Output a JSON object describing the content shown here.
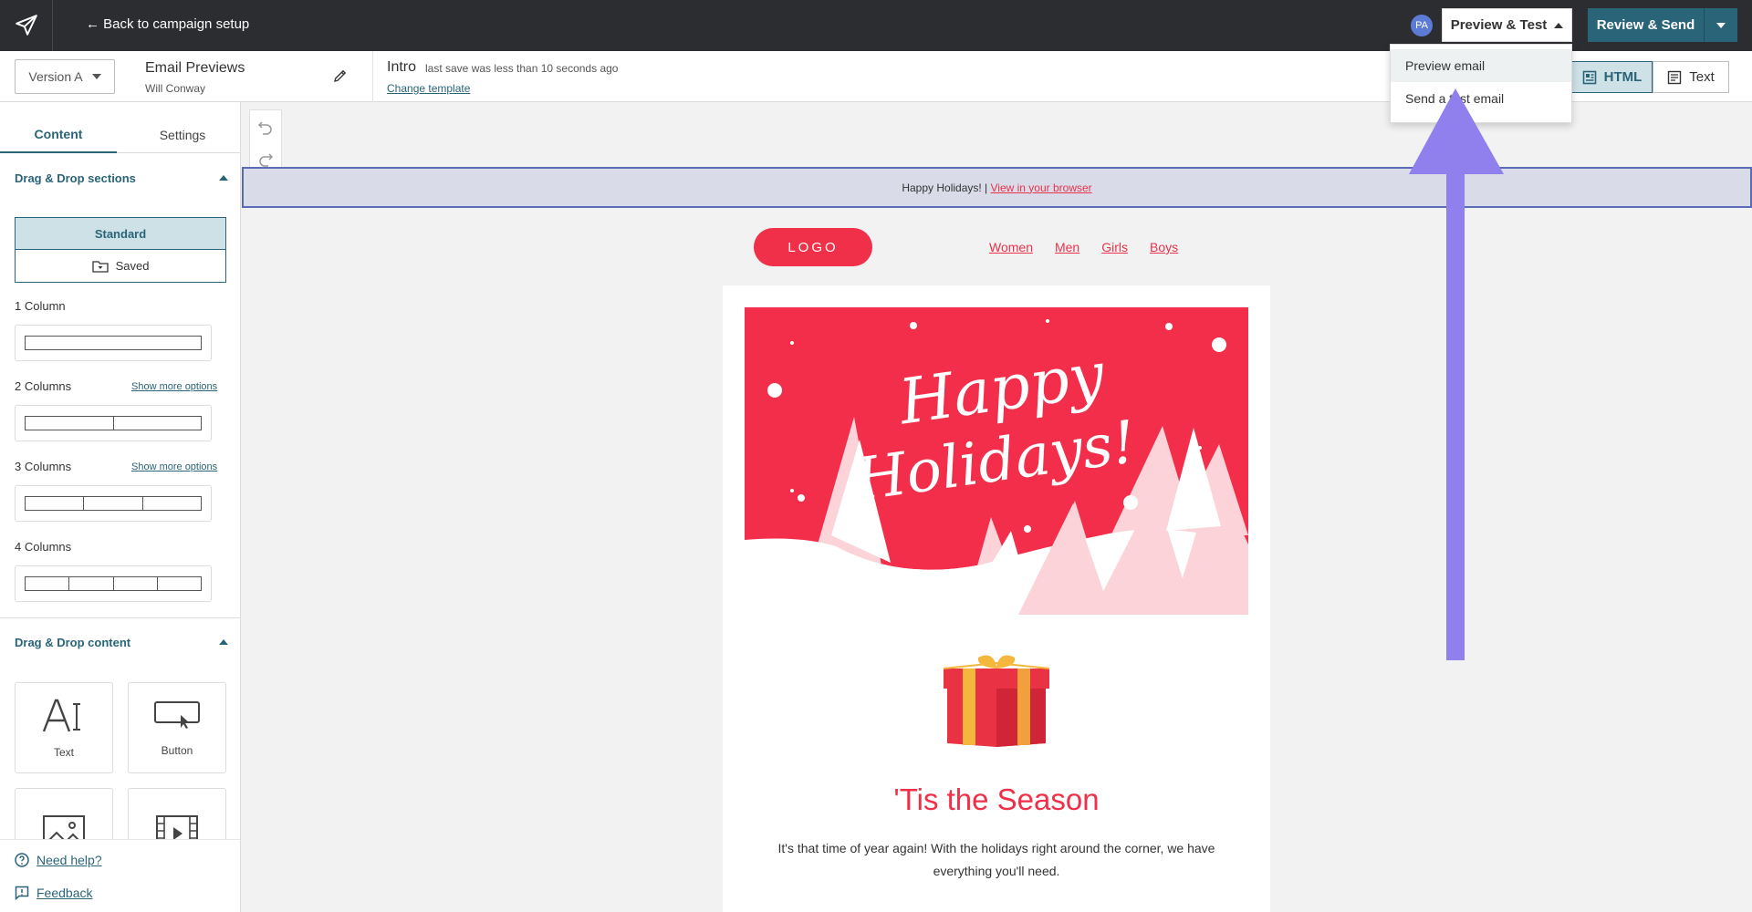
{
  "topbar": {
    "back_label": "← Back to campaign setup",
    "avatar_initials": "PA",
    "preview_test_label": "Preview & Test",
    "review_send_label": "Review & Send"
  },
  "dropdown": {
    "items": [
      "Preview email",
      "Send a test email"
    ]
  },
  "subbar": {
    "version_label": "Version A",
    "campaign_title": "Email Previews",
    "owner": "Will Conway",
    "step_name": "Intro",
    "save_status": "last save was less than 10 seconds ago",
    "change_template_label": "Change template",
    "html_label": "HTML",
    "text_label": "Text"
  },
  "sidebar": {
    "tabs": [
      "Content",
      "Settings"
    ],
    "sections_heading": "Drag & Drop sections",
    "standard_label": "Standard",
    "saved_label": "Saved",
    "columns": [
      {
        "label": "1 Column",
        "more": ""
      },
      {
        "label": "2 Columns",
        "more": "Show more options"
      },
      {
        "label": "3 Columns",
        "more": "Show more options"
      },
      {
        "label": "4 Columns",
        "more": ""
      }
    ],
    "content_heading": "Drag & Drop content",
    "tiles": [
      "Text",
      "Button"
    ],
    "help_label": "Need help?",
    "feedback_label": "Feedback"
  },
  "email": {
    "preheader_text": "Happy Holidays! |",
    "browser_link": "View in your browser",
    "logo_text": "LOGO",
    "nav": [
      "Women",
      "Men",
      "Girls",
      "Boys"
    ],
    "hero_script_line1": "Happy",
    "hero_script_line2": "Holidays!",
    "headline": "'Tis the Season",
    "body": "It's that time of year again! With the holidays right around the corner, we have everything you'll need."
  },
  "colors": {
    "topbar_bg": "#2c2d31",
    "accent_teal": "#2a6478",
    "brand_red": "#ef3048",
    "arrow_purple": "#8f80ee"
  }
}
